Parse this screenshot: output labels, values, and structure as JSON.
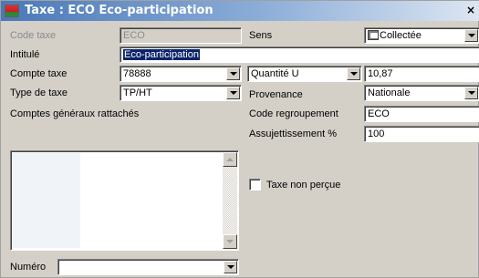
{
  "window": {
    "title": "Taxe : ECO Eco-participation",
    "close_glyph": "×"
  },
  "form": {
    "code_taxe": {
      "label": "Code taxe",
      "value": "ECO",
      "enabled": false
    },
    "sens": {
      "label": "Sens",
      "value": "Collectée",
      "icon": "collect-icon"
    },
    "intitule": {
      "label": "Intitulé",
      "value": "Eco-participation"
    },
    "compte_taxe": {
      "label": "Compte taxe",
      "value": "78888"
    },
    "quantite": {
      "value": "Quantité U"
    },
    "taux": {
      "value": "10,87"
    },
    "type_taxe": {
      "label": "Type de taxe",
      "value": "TP/HT"
    },
    "provenance": {
      "label": "Provenance",
      "value": "Nationale"
    },
    "comptes_generaux": {
      "label": "Comptes généraux rattachés"
    },
    "code_regroupement": {
      "label": "Code regroupement",
      "value": "ECO"
    },
    "assujettissement": {
      "label": "Assujettissement %",
      "value": "100"
    },
    "taxe_non_percue": {
      "label": "Taxe non perçue",
      "checked": false
    },
    "numero": {
      "label": "Numéro",
      "value": ""
    }
  }
}
